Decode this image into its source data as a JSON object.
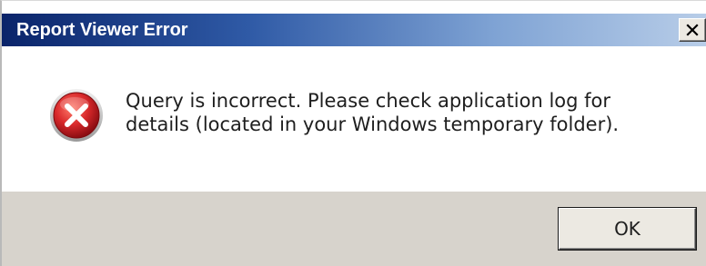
{
  "window": {
    "title": "Report Viewer Error",
    "close_label": "✕"
  },
  "message": {
    "line1": "Query is incorrect. Please check application log for",
    "line2": "details (located in your Windows temporary folder).",
    "icon": "error-icon"
  },
  "buttons": {
    "ok_label": "OK"
  },
  "colors": {
    "title_bar_start": "#0a246a",
    "title_bar_end": "#b8cde8",
    "error_red": "#d9292b",
    "footer_bg": "#d7d3cc"
  }
}
